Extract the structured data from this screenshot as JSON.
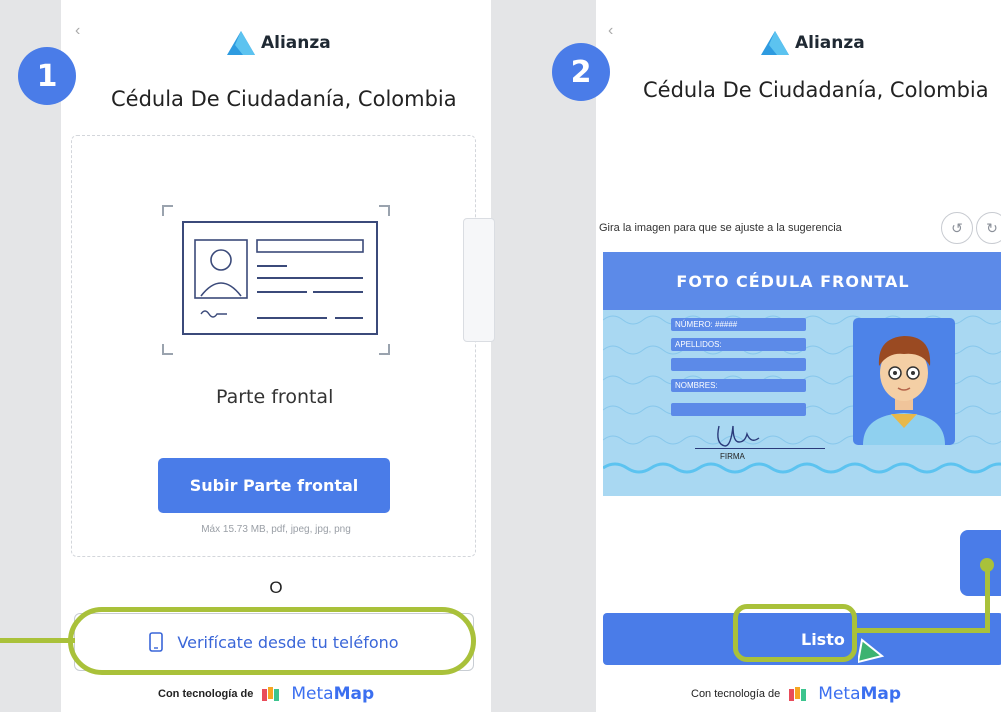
{
  "colors": {
    "accent": "#4a7ce8",
    "highlight": "#a9c13a",
    "background": "#e4e5e7"
  },
  "step1": {
    "badge": "1",
    "logo": "Alianza",
    "title": "Cédula De Ciudadanía, Colombia",
    "document_side_label": "Parte frontal",
    "upload_button": "Subir Parte frontal",
    "file_hint": "Máx 15.73 MB, pdf, jpeg, jpg, png",
    "or_label": "O",
    "phone_button": "Verifícate desde tu teléfono",
    "footer_prefix": "Con tecnología de",
    "brand_name_light": "Meta",
    "brand_name_bold": "Map"
  },
  "step2": {
    "badge": "2",
    "logo": "Alianza",
    "title": "Cédula De Ciudadanía, Colombia",
    "rotate_hint": "Gira la imagen para que se ajuste a la sugerencia",
    "card_title": "FOTO CÉDULA FRONTAL",
    "card_fields": [
      "NÚMERO: #####",
      "APELLIDOS:",
      "",
      "NOMBRES:",
      ""
    ],
    "signature_label": "FIRMA",
    "confirm_button": "Listo",
    "footer_prefix": "Con tecnología de",
    "brand_name_light": "Meta",
    "brand_name_bold": "Map"
  }
}
